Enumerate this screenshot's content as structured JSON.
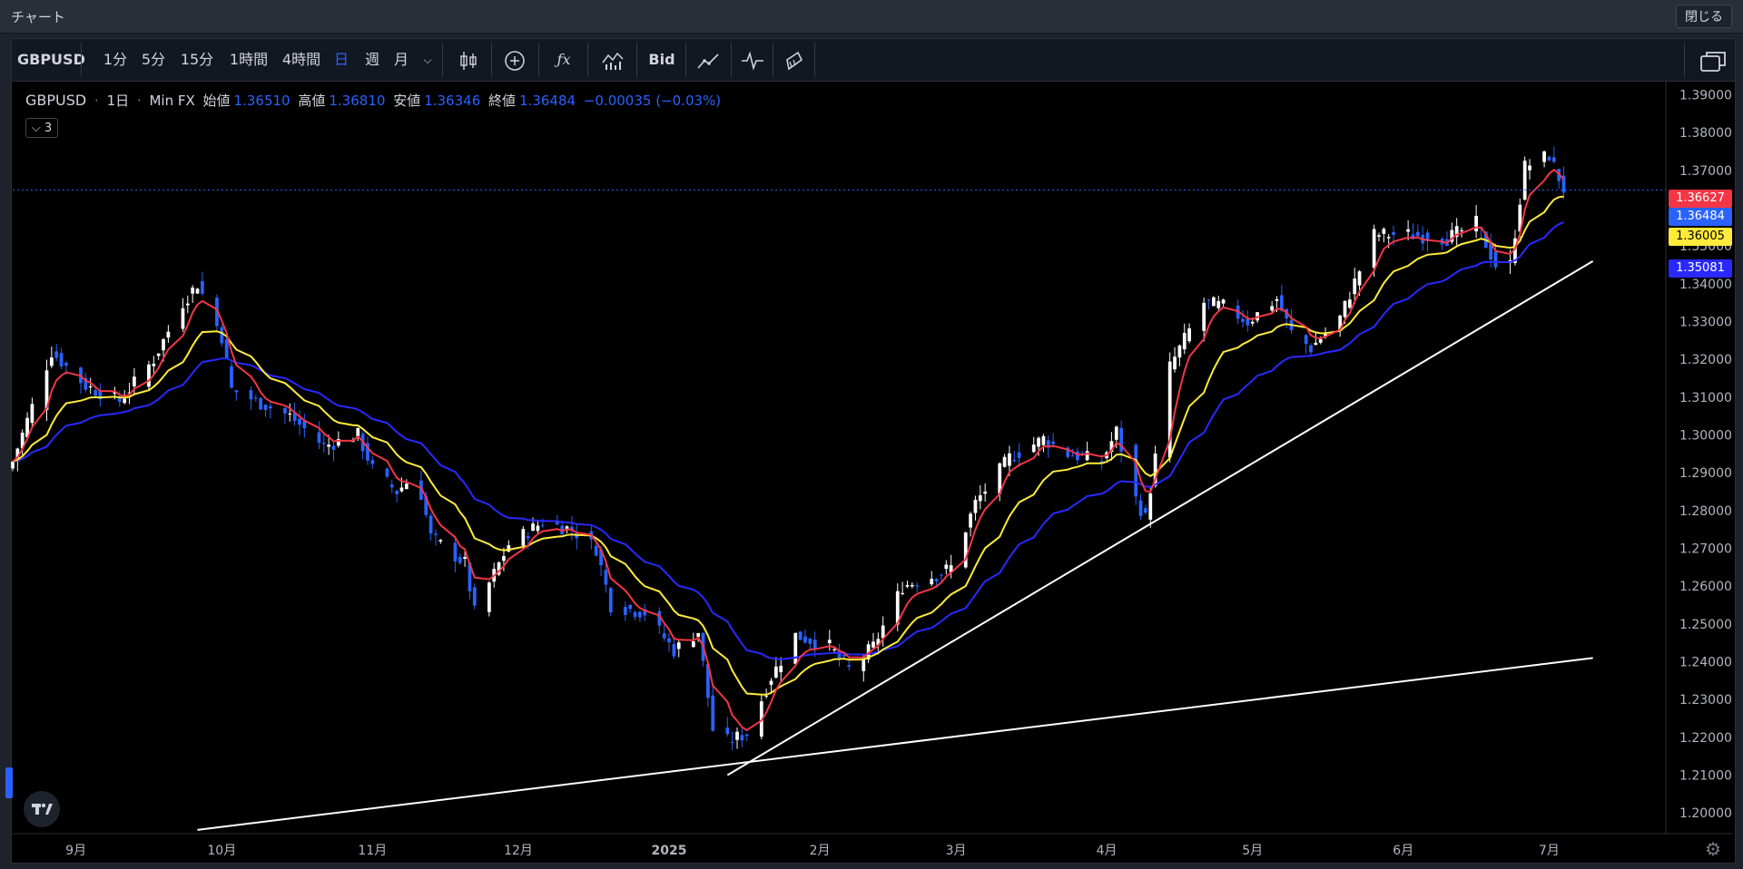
{
  "window": {
    "title": "チャート",
    "close_label": "閉じる"
  },
  "toolbar": {
    "symbol": "GBPUSD",
    "intervals": [
      "1分",
      "5分",
      "15分",
      "1時間",
      "4時間",
      "日",
      "週",
      "月"
    ],
    "active_interval": "日",
    "bid_label": "Bid",
    "icons": [
      "candle-style-icon",
      "add-indicator-icon",
      "function-icon",
      "chart-type-icon",
      "trend-icon",
      "pulse-icon",
      "brush-icon",
      "layout-icon"
    ]
  },
  "legend": {
    "symbol": "GBPUSD",
    "interval": "1日",
    "source": "Min FX",
    "open_label": "始値",
    "open": "1.36510",
    "high_label": "高値",
    "high": "1.36810",
    "low_label": "安値",
    "low": "1.36346",
    "close_label": "終値",
    "close": "1.36484",
    "change": "−0.00035 (−0.03%)",
    "indicator_count": "3"
  },
  "price_badges": [
    {
      "value": "1.36627",
      "color": "#f23645"
    },
    {
      "value": "1.36484",
      "color": "#2962ff"
    },
    {
      "value": "1.36005",
      "color": "#ffeb3b"
    },
    {
      "value": "1.35081",
      "color": "#2929ff"
    }
  ],
  "colors": {
    "up": "#ffffff",
    "down": "#2962ff",
    "ma_fast": "#f23645",
    "ma_mid": "#ffeb3b",
    "ma_slow": "#2929ff",
    "trendline": "#ffffff"
  },
  "chart_data": {
    "type": "candlestick",
    "title": "",
    "y_axis": {
      "ticks": [
        "1.39000",
        "1.38000",
        "1.37000",
        "1.36000",
        "1.35000",
        "1.34000",
        "1.33000",
        "1.32000",
        "1.31000",
        "1.30000",
        "1.29000",
        "1.28000",
        "1.27000",
        "1.26000",
        "1.25000",
        "1.24000",
        "1.23000",
        "1.22000",
        "1.21000",
        "1.20000"
      ],
      "ylim": [
        1.195,
        1.393
      ]
    },
    "x_axis": {
      "ticks": [
        "9月",
        "10月",
        "11月",
        "12月",
        "2025",
        "2月",
        "3月",
        "4月",
        "5月",
        "6月",
        "7月"
      ]
    },
    "price_path": [
      [
        "2024-08-19",
        1.293
      ],
      [
        "2024-08-27",
        1.322
      ],
      [
        "2024-09-03",
        1.313
      ],
      [
        "2024-09-10",
        1.309
      ],
      [
        "2024-09-17",
        1.32
      ],
      [
        "2024-09-23",
        1.335
      ],
      [
        "2024-09-26",
        1.34
      ],
      [
        "2024-10-01",
        1.326
      ],
      [
        "2024-10-03",
        1.312
      ],
      [
        "2024-10-08",
        1.309
      ],
      [
        "2024-10-15",
        1.305
      ],
      [
        "2024-10-22",
        1.297
      ],
      [
        "2024-10-29",
        1.3
      ],
      [
        "2024-11-01",
        1.291
      ],
      [
        "2024-11-06",
        1.285
      ],
      [
        "2024-11-10",
        1.29
      ],
      [
        "2024-11-13",
        1.273
      ],
      [
        "2024-11-20",
        1.266
      ],
      [
        "2024-11-22",
        1.253
      ],
      [
        "2024-11-29",
        1.271
      ],
      [
        "2024-12-06",
        1.277
      ],
      [
        "2024-12-12",
        1.275
      ],
      [
        "2024-12-17",
        1.27
      ],
      [
        "2024-12-20",
        1.255
      ],
      [
        "2024-12-27",
        1.253
      ],
      [
        "2025-01-02",
        1.243
      ],
      [
        "2025-01-07",
        1.248
      ],
      [
        "2025-01-10",
        1.222
      ],
      [
        "2025-01-13",
        1.219
      ],
      [
        "2025-01-17",
        1.221
      ],
      [
        "2025-01-22",
        1.236
      ],
      [
        "2025-01-27",
        1.247
      ],
      [
        "2025-02-03",
        1.244
      ],
      [
        "2025-02-07",
        1.238
      ],
      [
        "2025-02-12",
        1.244
      ],
      [
        "2025-02-18",
        1.26
      ],
      [
        "2025-02-25",
        1.263
      ],
      [
        "2025-02-28",
        1.265
      ],
      [
        "2025-03-05",
        1.282
      ],
      [
        "2025-03-12",
        1.294
      ],
      [
        "2025-03-19",
        1.299
      ],
      [
        "2025-03-24",
        1.295
      ],
      [
        "2025-03-31",
        1.293
      ],
      [
        "2025-04-03",
        1.301
      ],
      [
        "2025-04-07",
        1.283
      ],
      [
        "2025-04-09",
        1.278
      ],
      [
        "2025-04-14",
        1.318
      ],
      [
        "2025-04-21",
        1.335
      ],
      [
        "2025-04-25",
        1.334
      ],
      [
        "2025-04-30",
        1.33
      ],
      [
        "2025-05-06",
        1.336
      ],
      [
        "2025-05-09",
        1.327
      ],
      [
        "2025-05-13",
        1.323
      ],
      [
        "2025-05-19",
        1.331
      ],
      [
        "2025-05-26",
        1.353
      ],
      [
        "2025-06-02",
        1.353
      ],
      [
        "2025-06-10",
        1.352
      ],
      [
        "2025-06-16",
        1.356
      ],
      [
        "2025-06-20",
        1.345
      ],
      [
        "2025-06-23",
        1.345
      ],
      [
        "2025-06-26",
        1.371
      ],
      [
        "2025-07-01",
        1.374
      ],
      [
        "2025-07-04",
        1.365
      ]
    ],
    "moving_averages": [
      {
        "name": "",
        "color": "#f23645",
        "last": 1.36627
      },
      {
        "name": "",
        "color": "#ffeb3b",
        "last": 1.36005
      },
      {
        "name": "",
        "color": "#2929ff",
        "last": 1.35081
      }
    ],
    "trendlines": [
      {
        "from": [
          "2025-01-13",
          1.21
        ],
        "to": [
          "2025-07-10",
          1.346
        ]
      },
      {
        "from": [
          "2024-09-26",
          1.1955
        ],
        "to": [
          "2025-07-10",
          1.241
        ]
      }
    ]
  }
}
